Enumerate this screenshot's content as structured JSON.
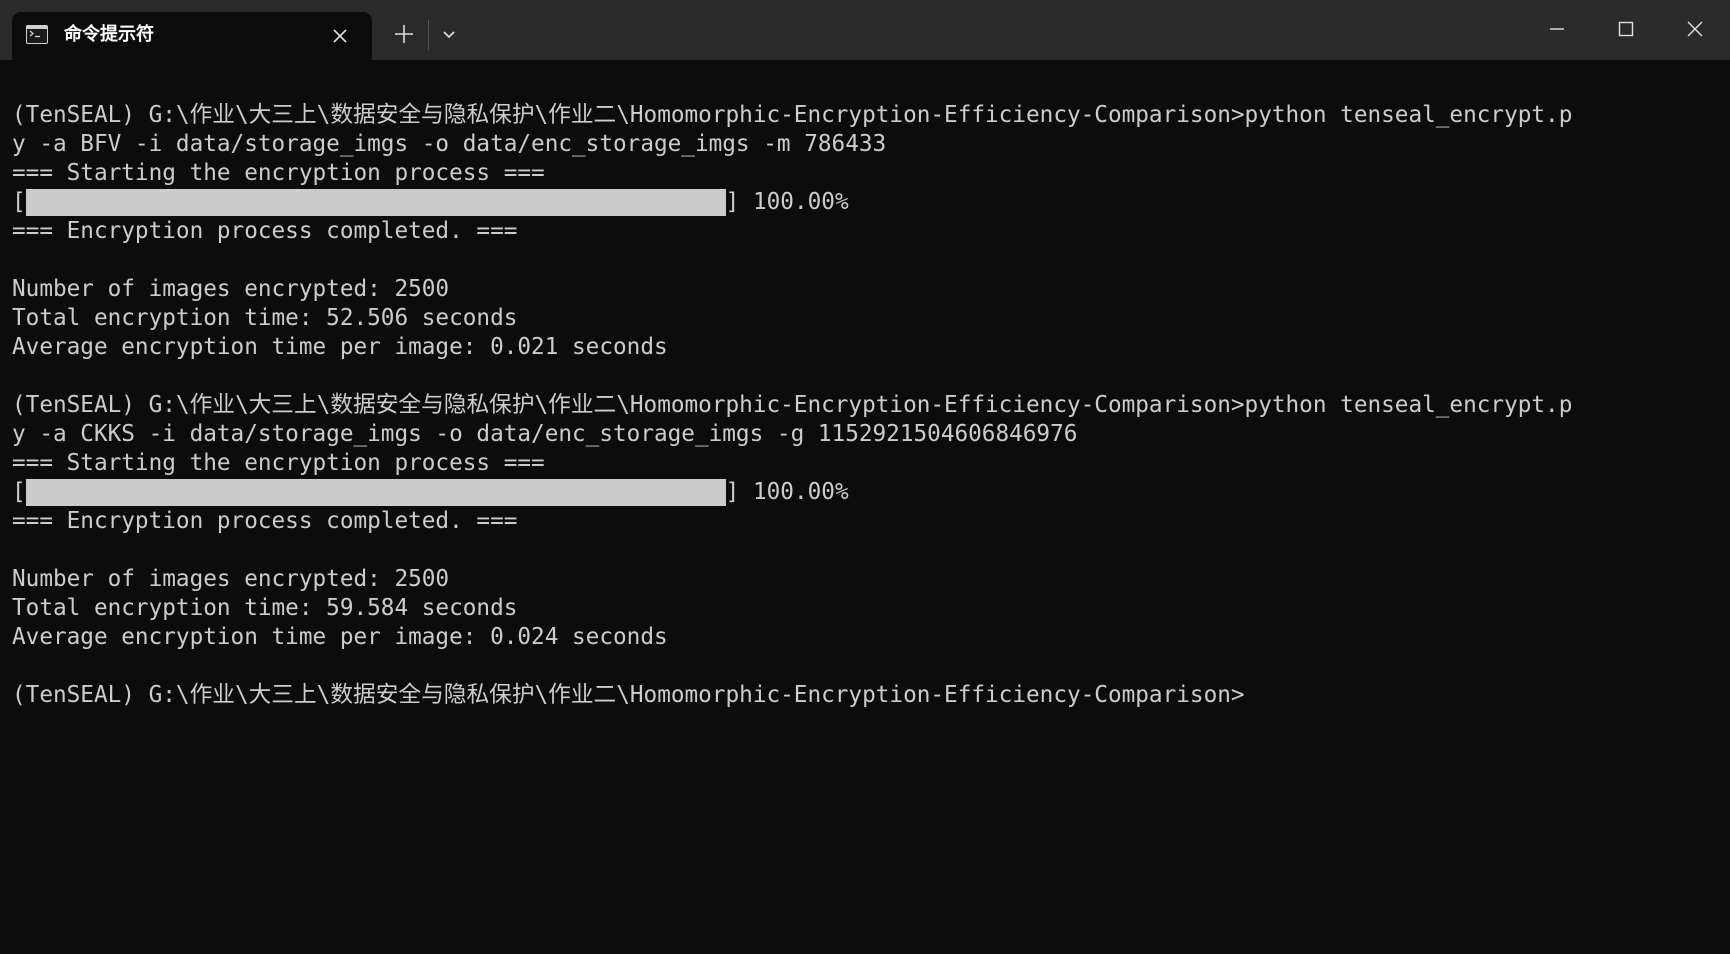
{
  "window": {
    "tab_title": "命令提示符",
    "icons": {
      "tab": "cmd-icon",
      "close_tab": "close-icon",
      "new_tab": "plus-icon",
      "dropdown": "chevron-down-icon",
      "minimize": "minimize-icon",
      "maximize": "maximize-icon",
      "close": "close-icon"
    }
  },
  "colors": {
    "background": "#0c0c0c",
    "titlebar": "#2b2b2b",
    "text": "#cccccc"
  },
  "terminal": {
    "lines": [
      {
        "kind": "text",
        "text": ""
      },
      {
        "kind": "text",
        "text": "(TenSEAL) G:\\作业\\大三上\\数据安全与隐私保护\\作业二\\Homomorphic-Encryption-Efficiency-Comparison>python tenseal_encrypt.p"
      },
      {
        "kind": "text",
        "text": "y -a BFV -i data/storage_imgs -o data/enc_storage_imgs -m 786433"
      },
      {
        "kind": "text",
        "text": "=== Starting the encryption process ==="
      },
      {
        "kind": "progress",
        "open": "[",
        "close": "] 100.00%",
        "progress": 1.0
      },
      {
        "kind": "text",
        "text": "=== Encryption process completed. ==="
      },
      {
        "kind": "text",
        "text": ""
      },
      {
        "kind": "text",
        "text": "Number of images encrypted: 2500"
      },
      {
        "kind": "text",
        "text": "Total encryption time: 52.506 seconds"
      },
      {
        "kind": "text",
        "text": "Average encryption time per image: 0.021 seconds"
      },
      {
        "kind": "text",
        "text": ""
      },
      {
        "kind": "text",
        "text": "(TenSEAL) G:\\作业\\大三上\\数据安全与隐私保护\\作业二\\Homomorphic-Encryption-Efficiency-Comparison>python tenseal_encrypt.p"
      },
      {
        "kind": "text",
        "text": "y -a CKKS -i data/storage_imgs -o data/enc_storage_imgs -g 1152921504606846976"
      },
      {
        "kind": "text",
        "text": "=== Starting the encryption process ==="
      },
      {
        "kind": "progress",
        "open": "[",
        "close": "] 100.00%",
        "progress": 1.0
      },
      {
        "kind": "text",
        "text": "=== Encryption process completed. ==="
      },
      {
        "kind": "text",
        "text": ""
      },
      {
        "kind": "text",
        "text": "Number of images encrypted: 2500"
      },
      {
        "kind": "text",
        "text": "Total encryption time: 59.584 seconds"
      },
      {
        "kind": "text",
        "text": "Average encryption time per image: 0.024 seconds"
      },
      {
        "kind": "text",
        "text": ""
      },
      {
        "kind": "text",
        "text": "(TenSEAL) G:\\作业\\大三上\\数据安全与隐私保护\\作业二\\Homomorphic-Encryption-Efficiency-Comparison>"
      }
    ]
  }
}
